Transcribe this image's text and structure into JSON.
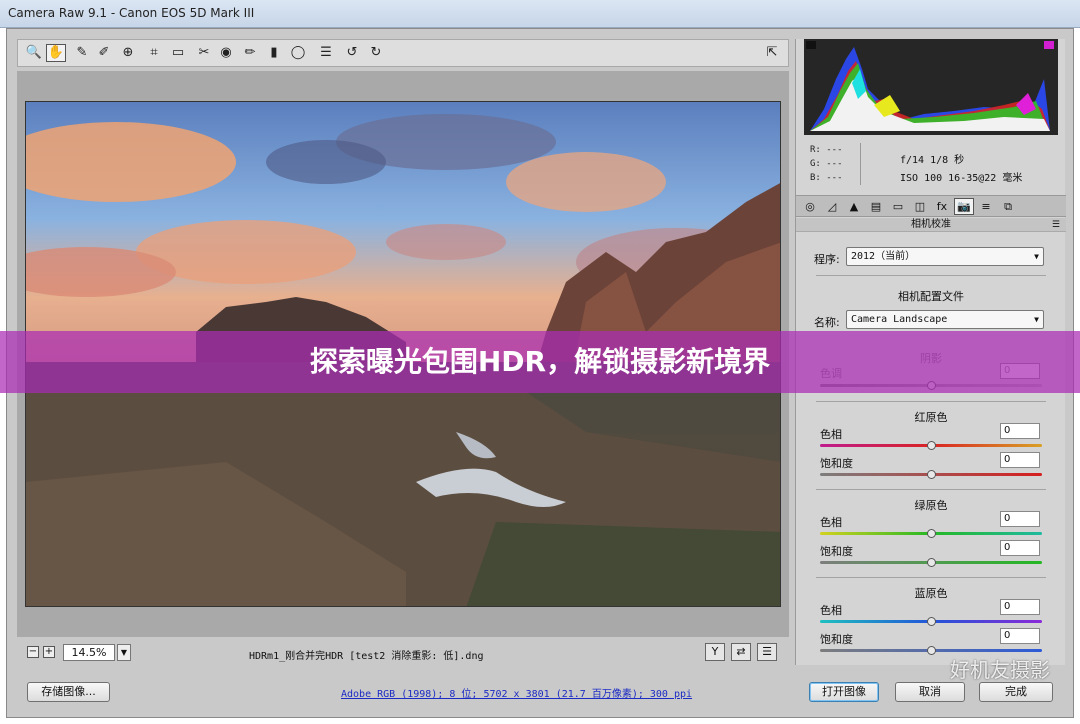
{
  "window": {
    "title": "Camera Raw 9.1  -  Canon EOS 5D Mark III"
  },
  "toolbar": {
    "tools": [
      {
        "name": "zoom-tool",
        "glyph": "🔍"
      },
      {
        "name": "hand-tool",
        "glyph": "✋"
      },
      {
        "name": "white-balance-tool",
        "glyph": "✎"
      },
      {
        "name": "color-sampler-tool",
        "glyph": "✐"
      },
      {
        "name": "targeted-adjustment-tool",
        "glyph": "⊕"
      },
      {
        "name": "crop-tool",
        "glyph": "⌗"
      },
      {
        "name": "straighten-tool",
        "glyph": "▭"
      },
      {
        "name": "spot-removal-tool",
        "glyph": "✂"
      },
      {
        "name": "red-eye-tool",
        "glyph": "◉"
      },
      {
        "name": "adjustment-brush-tool",
        "glyph": "✏"
      },
      {
        "name": "graduated-filter-tool",
        "glyph": "▮"
      },
      {
        "name": "radial-filter-tool",
        "glyph": "◯"
      },
      {
        "name": "preferences-tool",
        "glyph": "☰"
      },
      {
        "name": "rotate-ccw-tool",
        "glyph": "↺"
      },
      {
        "name": "rotate-cw-tool",
        "glyph": "↻"
      }
    ],
    "fullscreen_glyph": "⇱"
  },
  "status": {
    "zoom": "14.5%",
    "filename": "HDRm1_刚合并完HDR [test2 消除重影: 低].dng"
  },
  "readout": {
    "r": "R:  ---",
    "g": "G:  ---",
    "b": "B:  ---",
    "exposure": "f/14   1/8 秒",
    "lens": "ISO 100   16-35@22 毫米"
  },
  "panel": {
    "tabs": [
      "◎",
      "◿",
      "▲",
      "▤",
      "▭",
      "◫",
      "fx",
      "📷",
      "≡",
      "⧉"
    ],
    "section_title": "相机校准",
    "process_label": "程序:",
    "process_value": "2012（当前）",
    "profile_group": "相机配置文件",
    "name_label": "名称:",
    "name_value": "Camera Landscape",
    "shadows_title": "阴影",
    "tint_label": "色调",
    "tint_value": "0",
    "red_title": "红原色",
    "hue_label": "色相",
    "sat_label": "饱和度",
    "red_hue": "0",
    "red_sat": "0",
    "green_title": "绿原色",
    "green_hue": "0",
    "green_sat": "0",
    "blue_title": "蓝原色",
    "blue_hue": "0",
    "blue_sat": "0"
  },
  "footer": {
    "save": "存储图像...",
    "workflow": "Adobe RGB (1998); 8 位;  5702 x 3801 (21.7 百万像素); 300 ppi",
    "open": "打开图像",
    "cancel": "取消",
    "done": "完成"
  },
  "watermark": "好机友摄影",
  "banner": "探索曝光包围HDR，解锁摄影新境界"
}
